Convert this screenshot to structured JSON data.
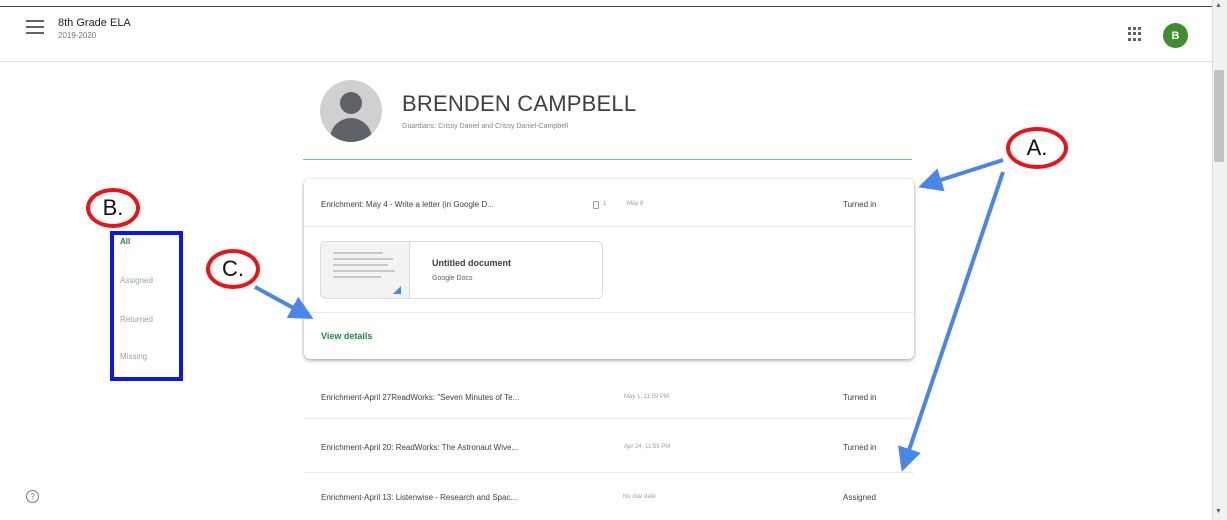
{
  "header": {
    "class_title": "8th Grade ELA",
    "class_subtitle": "2019-2020",
    "avatar_letter": "B"
  },
  "student": {
    "name": "BRENDEN CAMPBELL",
    "guardians": "Guardians: Crissy Daniel and Crissy Daniel-Campbell"
  },
  "filters": [
    "All",
    "Assigned",
    "Returned",
    "Missing"
  ],
  "selected_filter": "All",
  "expanded_item": {
    "title": "Enrichment: May 4 - Write a letter (in Google D...",
    "attachment_count": "1",
    "due": "May 8",
    "status": "Turned in",
    "attachment": {
      "name": "Untitled document",
      "type": "Google Docs"
    },
    "view_details": "View details"
  },
  "assignments": [
    {
      "title": "Enrichment-April 27ReadWorks: \"Seven Minutes of Te...",
      "due": "May 1, 11:59 PM",
      "status": "Turned in"
    },
    {
      "title": "Enrichment-April 20: ReadWorks: The Astronaut Wive...",
      "due": "Apr 24, 11:59 PM",
      "status": "Turned in"
    },
    {
      "title": "Enrichment-April 13: Listenwise - Research and Spac...",
      "due": "No due date",
      "status": "Assigned"
    }
  ],
  "annotations": {
    "a": "A.",
    "b": "B.",
    "c": "C."
  },
  "colors": {
    "accent_green": "#1e8e3e",
    "annotation_red": "#e8141a",
    "annotation_blue": "#0b16e8",
    "arrow_blue": "#4a86e8"
  },
  "icons": {
    "menu": "hamburger-menu-icon",
    "apps": "apps-grid-icon",
    "help": "help-circle-icon",
    "attachment": "attachment-icon"
  }
}
